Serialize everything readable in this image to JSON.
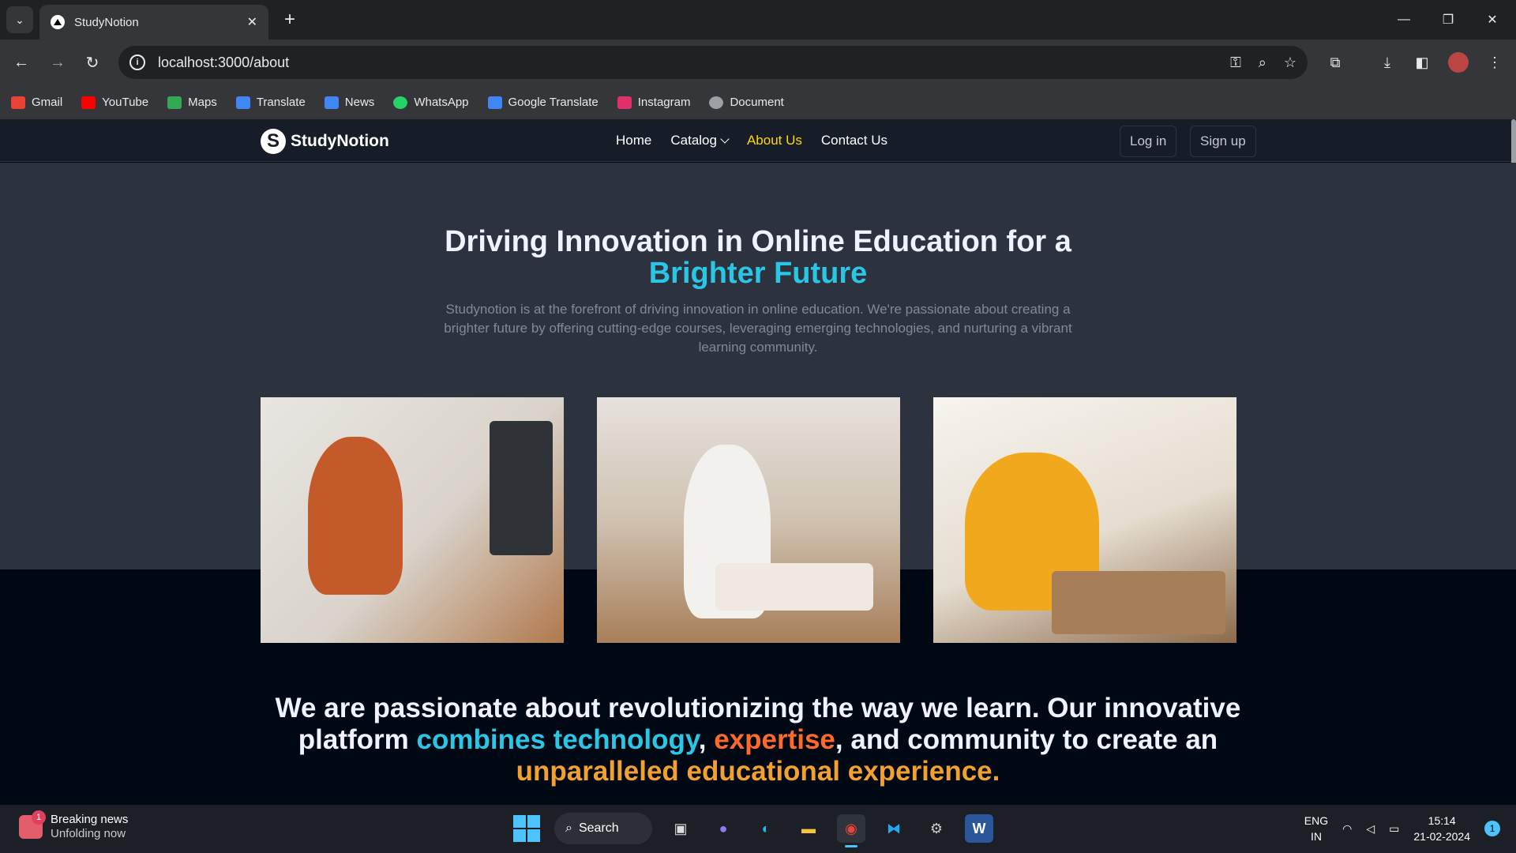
{
  "browser": {
    "tab_title": "StudyNotion",
    "url": "localhost:3000/about",
    "bookmarks": [
      {
        "label": "Gmail",
        "color": "#ea4335"
      },
      {
        "label": "YouTube",
        "color": "#ff0000"
      },
      {
        "label": "Maps",
        "color": "#34a853"
      },
      {
        "label": "Translate",
        "color": "#4285f4"
      },
      {
        "label": "News",
        "color": "#4285f4"
      },
      {
        "label": "WhatsApp",
        "color": "#25d366"
      },
      {
        "label": "Google Translate",
        "color": "#4285f4"
      },
      {
        "label": "Instagram",
        "color": "#e1306c"
      },
      {
        "label": "Document",
        "color": "#9aa0a6"
      }
    ]
  },
  "navbar": {
    "brand": "StudyNotion",
    "brand_mark": "S",
    "links": {
      "home": "Home",
      "catalog": "Catalog",
      "about": "About Us",
      "contact": "Contact Us"
    },
    "login": "Log in",
    "signup": "Sign up"
  },
  "hero": {
    "title_line1": "Driving Innovation in Online Education for a",
    "title_highlight": "Brighter Future",
    "description": "Studynotion is at the forefront of driving innovation in online education. We're passionate about creating a brighter future by offering cutting-edge courses, leveraging emerging technologies, and nurturing a vibrant learning community."
  },
  "quote": {
    "part1": "We are passionate about revolutionizing the way we learn. Our innovative platform",
    "highlight1": "combines technology",
    "comma1": ",",
    "highlight2": "expertise",
    "part2": ", and community to create an",
    "highlight3": "unparalleled educational experience."
  },
  "taskbar": {
    "news_title": "Breaking news",
    "news_sub": "Unfolding now",
    "news_badge": "1",
    "search": "Search",
    "lang1": "ENG",
    "lang2": "IN",
    "time": "15:14",
    "date": "21-02-2024",
    "notif": "1"
  },
  "colors": {
    "accent_yellow": "#ffd60a",
    "accent_blue": "#2ac6e6",
    "accent_orange": "#ff6a2c",
    "accent_gold": "#f3a02e"
  }
}
